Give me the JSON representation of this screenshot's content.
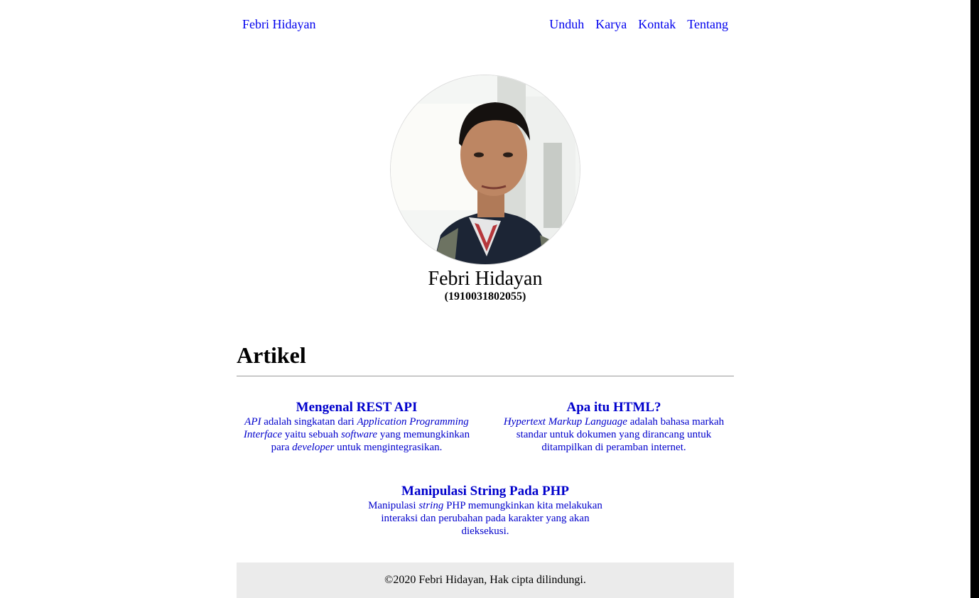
{
  "nav": {
    "brand": "Febri Hidayan",
    "links": [
      "Unduh",
      "Karya",
      "Kontak",
      "Tentang"
    ]
  },
  "profile": {
    "name": "Febri Hidayan",
    "id": "(1910031802055)"
  },
  "section": {
    "title": "Artikel"
  },
  "articles": [
    {
      "title": "Mengenal REST API",
      "parts": [
        {
          "t": "API",
          "i": true
        },
        {
          "t": " adalah singkatan dari ",
          "i": false
        },
        {
          "t": "Application Programming Interface",
          "i": true
        },
        {
          "t": " yaitu sebuah ",
          "i": false
        },
        {
          "t": "software",
          "i": true
        },
        {
          "t": " yang memungkinkan para ",
          "i": false
        },
        {
          "t": "developer",
          "i": true
        },
        {
          "t": " untuk mengintegrasikan.",
          "i": false
        }
      ]
    },
    {
      "title": "Apa itu HTML?",
      "parts": [
        {
          "t": "Hypertext Markup Language",
          "i": true
        },
        {
          "t": " adalah bahasa markah standar untuk dokumen yang dirancang untuk ditampilkan di peramban internet.",
          "i": false
        }
      ]
    },
    {
      "title": "Manipulasi String Pada PHP",
      "parts": [
        {
          "t": "Manipulasi ",
          "i": false
        },
        {
          "t": "string",
          "i": true
        },
        {
          "t": " PHP memungkinkan kita melakukan interaksi dan perubahan pada karakter yang akan dieksekusi.",
          "i": false
        }
      ]
    }
  ],
  "footer": {
    "text": "©2020 Febri Hidayan, Hak cipta dilindungi."
  }
}
